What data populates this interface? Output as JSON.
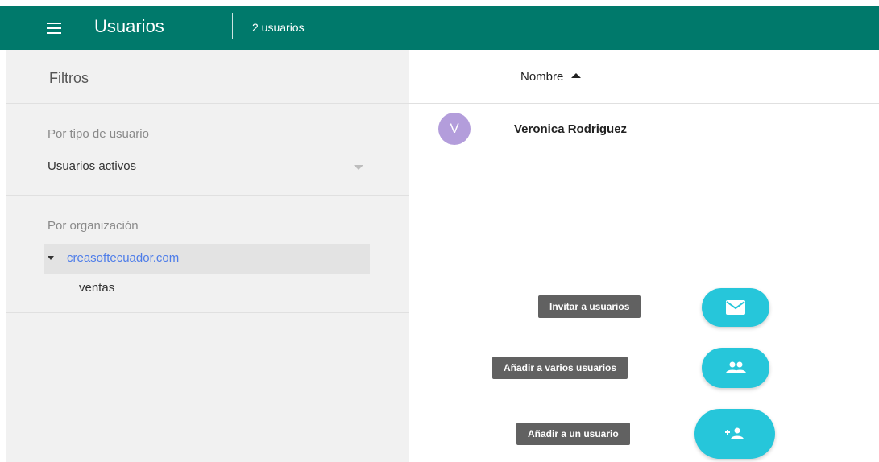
{
  "header": {
    "title": "Usuarios",
    "user_count": "2 usuarios",
    "menu_icon": "menu-icon",
    "background": "#00796b"
  },
  "sidebar": {
    "title": "Filtros",
    "user_type": {
      "label": "Por tipo de usuario",
      "selected": "Usuarios activos"
    },
    "organization": {
      "label": "Por organización",
      "root": "creasoftecuador.com",
      "children": [
        "ventas"
      ]
    }
  },
  "table": {
    "column_header": "Nombre",
    "rows": [
      {
        "avatar_initial": "V",
        "name": "Veronica Rodriguez",
        "avatar_color": "#b39ddb"
      }
    ]
  },
  "actions": {
    "invite": "Invitar a usuarios",
    "add_multiple": "Añadir a varios usuarios",
    "add_one": "Añadir a un usuario",
    "fab_color": "#26c6da"
  }
}
